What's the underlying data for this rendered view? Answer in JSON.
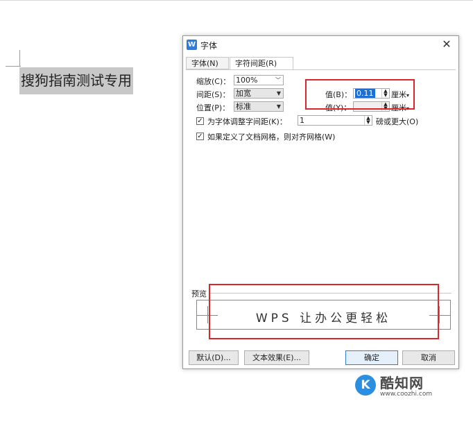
{
  "document": {
    "selected_text": "搜狗指南测试专用"
  },
  "dialog": {
    "title": "字体",
    "app_icon": "W",
    "close_glyph": "✕",
    "tabs": [
      {
        "label": "字体(N)"
      },
      {
        "label": "字符间距(R)"
      }
    ],
    "active_tab": "字符间距(R)",
    "scale": {
      "label": "缩放(C)：",
      "value": "100%"
    },
    "spacing": {
      "label": "间距(S)：",
      "value": "加宽",
      "amount_label": "值(B)：",
      "amount_value": "0.11",
      "unit": "厘米"
    },
    "position": {
      "label": "位置(P)：",
      "value": "标准",
      "amount_label": "值(Y)：",
      "amount_value": "",
      "unit": "厘米"
    },
    "kerning": {
      "checked": true,
      "label": "为字体调整字间距(K)：",
      "value": "1",
      "suffix": "磅或更大(O)"
    },
    "grid": {
      "checked": true,
      "label": "如果定义了文档网格，则对齐网格(W)"
    },
    "preview": {
      "label": "预览",
      "text": "WPS 让办公更轻松"
    },
    "buttons": {
      "default": "默认(D)...",
      "text_effects": "文本效果(E)...",
      "ok": "确定",
      "cancel": "取消"
    }
  },
  "annotations": {
    "highlight_color": "#d9262b"
  },
  "watermark": {
    "logo": "K",
    "name": "酷知网",
    "url": "www.coozhi.com"
  },
  "colors": {
    "selection_bg": "#1e6fd1",
    "dialog_border": "#7a9ec8",
    "ok_border": "#2e7dd1"
  }
}
